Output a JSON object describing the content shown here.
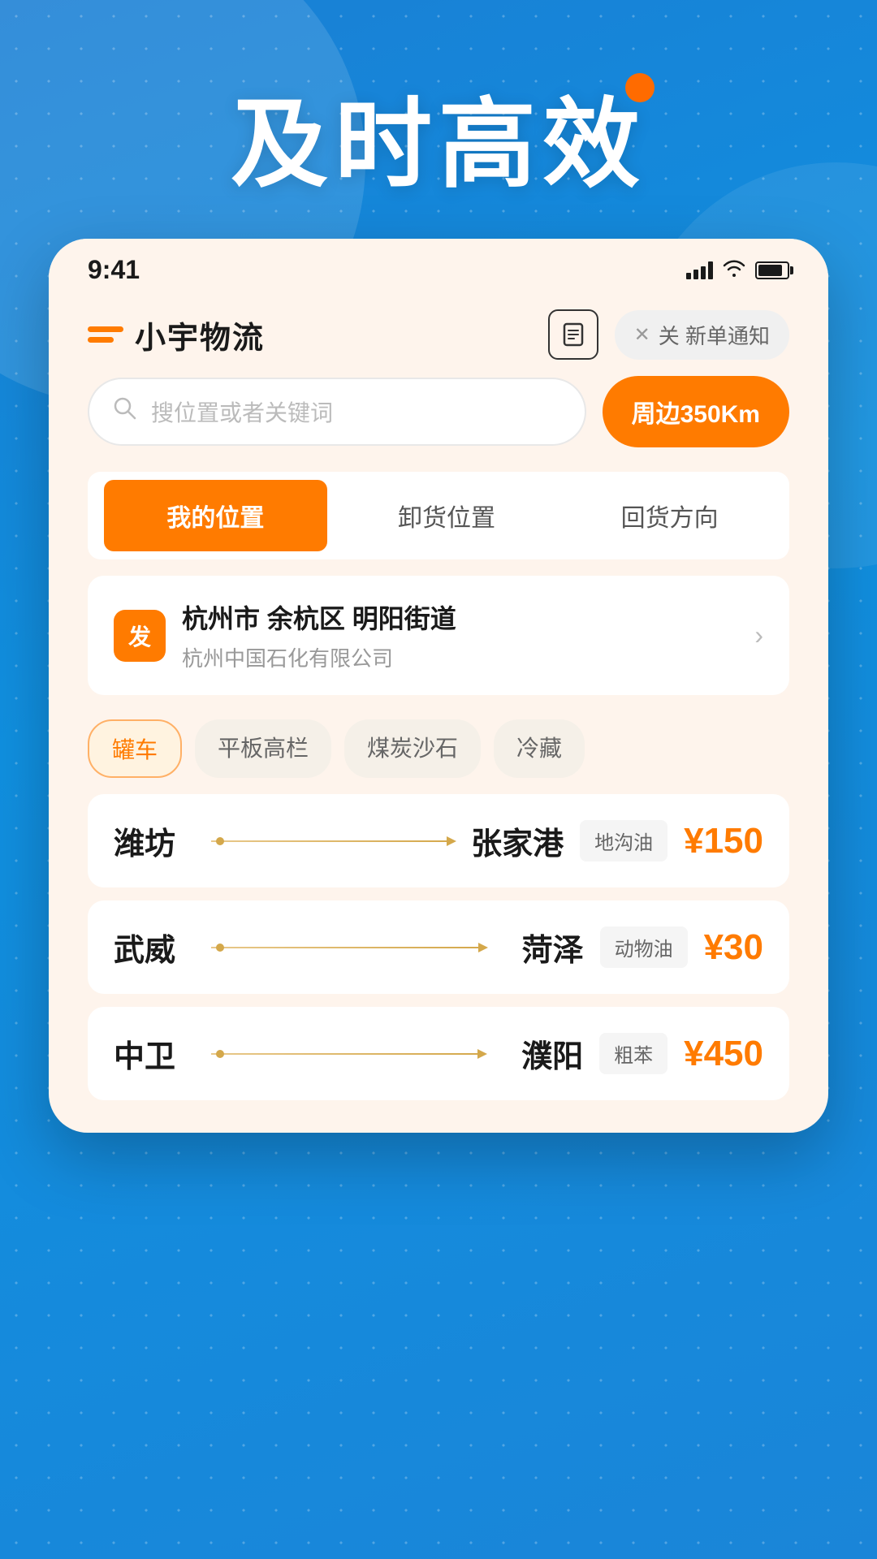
{
  "app": {
    "title": "小宇物流",
    "hero_text": "及时高效",
    "status_bar": {
      "time": "9:41"
    }
  },
  "header": {
    "note_icon": "📋",
    "notification_label": "关 新单通知"
  },
  "search": {
    "placeholder": "搜位置或者关键词",
    "nearby_btn": "周边350Km"
  },
  "tabs": [
    {
      "label": "我的位置",
      "active": true
    },
    {
      "label": "卸货位置",
      "active": false
    },
    {
      "label": "回货方向",
      "active": false
    }
  ],
  "location": {
    "badge": "发",
    "main": "杭州市 余杭区 明阳街道",
    "sub": "杭州中国石化有限公司"
  },
  "categories": [
    {
      "label": "罐车",
      "active": true
    },
    {
      "label": "平板高栏",
      "active": false
    },
    {
      "label": "煤炭沙石",
      "active": false
    },
    {
      "label": "冷藏",
      "active": false
    }
  ],
  "freight_items": [
    {
      "from": "潍坊",
      "to": "张家港",
      "tag": "地沟油",
      "price": "¥150"
    },
    {
      "from": "武威",
      "to": "菏泽",
      "tag": "动物油",
      "price": "¥30"
    },
    {
      "from": "中卫",
      "to": "濮阳",
      "tag": "粗苯",
      "price": "¥450"
    }
  ]
}
